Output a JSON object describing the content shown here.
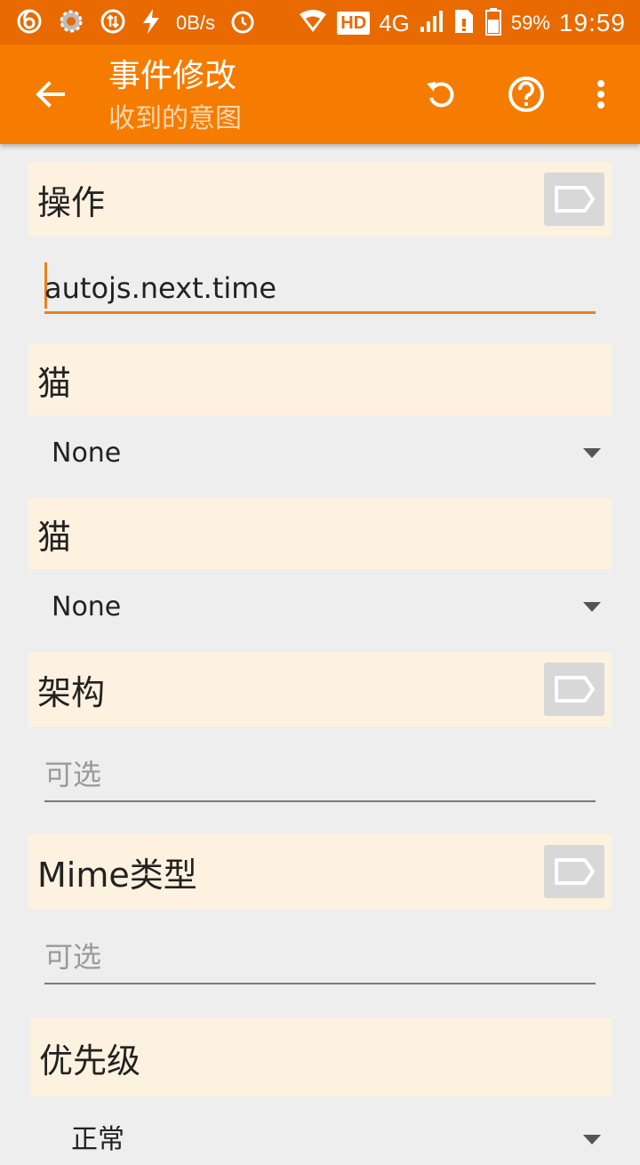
{
  "status_bar": {
    "net_speed": "0B/s",
    "hd": "HD",
    "network": "4G",
    "battery": "59%",
    "time": "19:59"
  },
  "toolbar": {
    "title": "事件修改",
    "subtitle": "收到的意图",
    "icons": [
      "back-arrow",
      "undo",
      "help",
      "more-vert"
    ]
  },
  "form": {
    "action": {
      "label": "操作",
      "value": "autojs.next.time"
    },
    "category1": {
      "label": "猫",
      "value": "None"
    },
    "category2": {
      "label": "猫",
      "value": "None"
    },
    "scheme": {
      "label": "架构",
      "placeholder": "可选"
    },
    "mime": {
      "label": "Mime类型",
      "placeholder": "可选"
    },
    "priority": {
      "label": "优先级",
      "value": "正常"
    }
  },
  "colors": {
    "status_bar": "#e86a00",
    "toolbar": "#f57c00",
    "section_bg": "#fdf2e0",
    "accent": "#e8821a"
  }
}
